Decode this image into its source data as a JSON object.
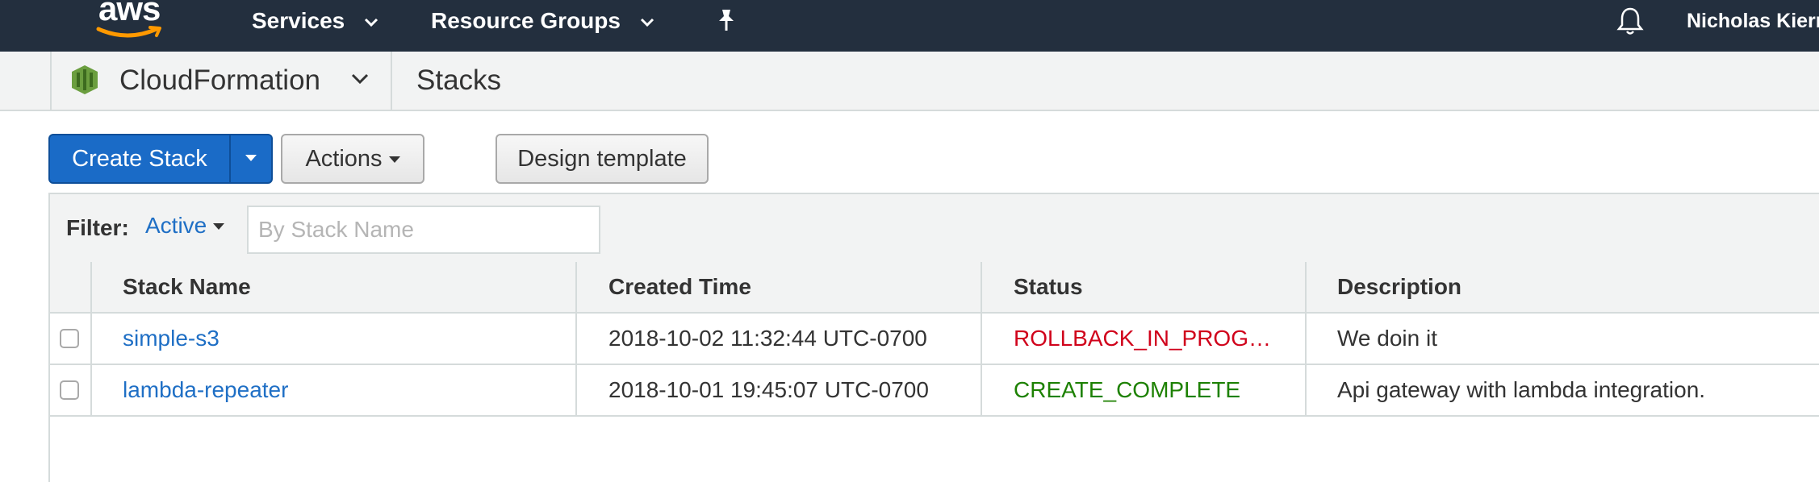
{
  "topnav": {
    "logo_text": "aws",
    "services_label": "Services",
    "resource_groups_label": "Resource Groups",
    "user_name": "Nicholas Kiern"
  },
  "service_bar": {
    "service_name": "CloudFormation",
    "page_title": "Stacks"
  },
  "toolbar": {
    "create_stack_label": "Create Stack",
    "actions_label": "Actions",
    "design_template_label": "Design template"
  },
  "filter": {
    "label": "Filter:",
    "selected": "Active",
    "placeholder": "By Stack Name"
  },
  "table": {
    "columns": [
      "Stack Name",
      "Created Time",
      "Status",
      "Description"
    ],
    "rows": [
      {
        "stack_name": "simple-s3",
        "created_time": "2018-10-02 11:32:44 UTC-0700",
        "status": "ROLLBACK_IN_PROG…",
        "description": "We doin it"
      },
      {
        "stack_name": "lambda-repeater",
        "created_time": "2018-10-01 19:45:07 UTC-0700",
        "status": "CREATE_COMPLETE",
        "description": "Api gateway with lambda integration."
      }
    ]
  },
  "colors": {
    "nav_bg": "#232f3e",
    "accent_orange": "#ff9900",
    "primary_blue": "#1a6bc7",
    "link_blue": "#1f6fc5",
    "status_rollback": "#d0021b",
    "status_complete": "#1d8102",
    "cf_icon_green": "#6b9e3f"
  }
}
